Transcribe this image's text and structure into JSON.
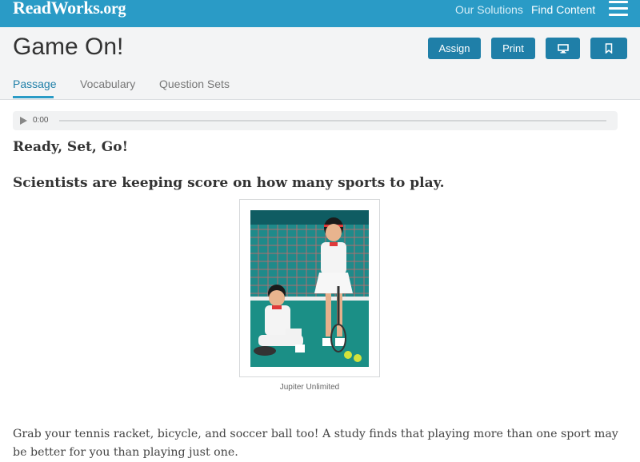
{
  "header": {
    "logo_main": "ReadWorks",
    "logo_suffix": ".org",
    "nav": [
      "Our Solutions",
      "Find Content"
    ],
    "menu_icon": "hamburger-menu-icon"
  },
  "article": {
    "title": "Game On!",
    "buttons": {
      "assign": "Assign",
      "print": "Print",
      "present_icon": "monitor-icon",
      "save_icon": "bookmark-icon"
    },
    "tabs": [
      "Passage",
      "Vocabulary",
      "Question Sets"
    ],
    "active_tab": "Passage"
  },
  "audio": {
    "time": "0:00",
    "play_icon": "play-icon"
  },
  "passage": {
    "title": "Ready, Set, Go!",
    "subtitle": "Scientists are keeping score on how many sports to play.",
    "image_caption": "Jupiter Unlimited",
    "paragraph": "Grab your tennis racket, bicycle, and soccer ball too! A study finds that playing more than one sport may be better for you than playing just one."
  },
  "colors": {
    "brand_blue": "#2a9bc6",
    "button_blue": "#1f7fa8"
  }
}
